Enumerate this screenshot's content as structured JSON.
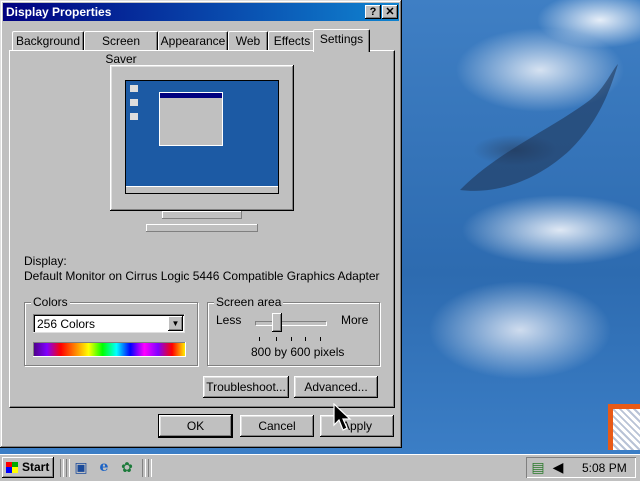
{
  "window": {
    "title": "Display Properties",
    "help_label": "?",
    "close_label": "✕"
  },
  "tabs": [
    {
      "label": "Background"
    },
    {
      "label": "Screen Saver"
    },
    {
      "label": "Appearance"
    },
    {
      "label": "Web"
    },
    {
      "label": "Effects"
    },
    {
      "label": "Settings",
      "active": true
    }
  ],
  "display": {
    "label": "Display:",
    "device": "Default Monitor on Cirrus Logic 5446 Compatible Graphics Adapter"
  },
  "colors": {
    "legend": "Colors",
    "selected": "256 Colors"
  },
  "screen_area": {
    "legend": "Screen area",
    "less_label": "Less",
    "more_label": "More",
    "value": "800 by 600 pixels",
    "slider_position": "2 of 5"
  },
  "buttons": {
    "troubleshoot": "Troubleshoot...",
    "advanced": "Advanced...",
    "ok": "OK",
    "cancel": "Cancel",
    "apply": "Apply"
  },
  "taskbar": {
    "start_label": "Start",
    "clock": "5:08 PM"
  },
  "icons": [
    "help-icon",
    "close-icon",
    "dropdown-arrow-icon",
    "windows-logo-icon",
    "desktop-icon",
    "ie-icon",
    "channels-icon",
    "scheduler-icon",
    "speaker-icon"
  ]
}
